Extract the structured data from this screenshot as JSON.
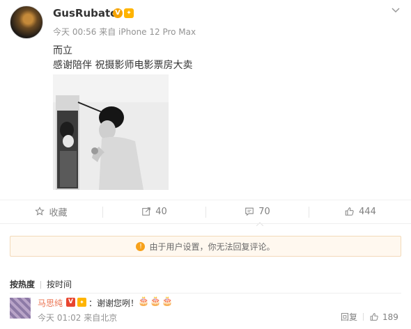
{
  "post": {
    "username": "GusRubato",
    "verified_badge": "V",
    "fan_badge_icon": "fan-badge-icon",
    "timestamp": "今天 00:56",
    "source": "来自 iPhone 12 Pro Max",
    "text_line1": "而立",
    "text_line2": "感谢陪伴 祝摄影师电影票房大卖"
  },
  "actions": {
    "favorite_label": "收藏",
    "repost_count": "40",
    "comment_count": "70",
    "like_count": "444"
  },
  "notice": {
    "icon": "!",
    "text": "由于用户设置，你无法回复评论。"
  },
  "comment_tabs": {
    "hot": "按热度",
    "time": "按时间"
  },
  "comment": {
    "name": "马思纯",
    "badge": "V",
    "text": "：谢谢您咧！",
    "emoji": "🎂🎂🎂",
    "timestamp": "今天 01:02",
    "source": "来自北京",
    "reply_label": "回复",
    "like_count": "189"
  },
  "colors": {
    "accent_orange": "#eb7350",
    "notice_bg": "#fff8ef",
    "badge_gold": "#f5a300"
  }
}
